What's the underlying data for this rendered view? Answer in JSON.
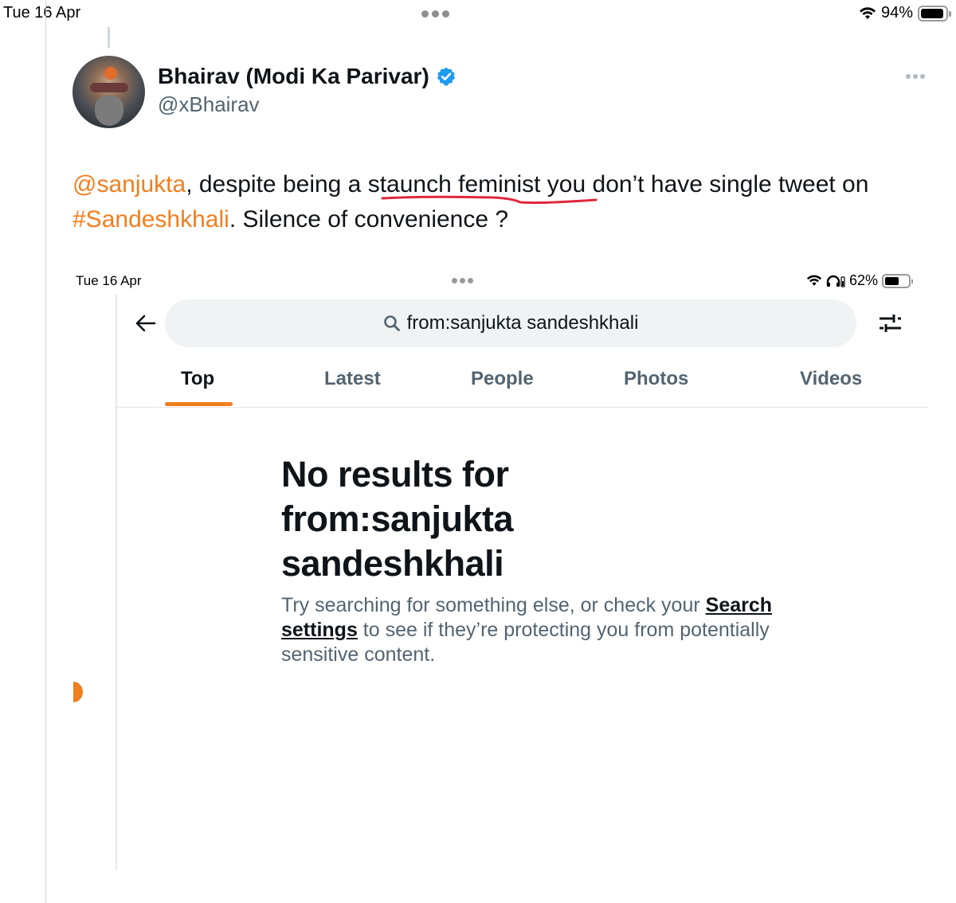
{
  "outer_status": {
    "time": "Tue 16 Apr",
    "battery_percent_label": "94%",
    "battery_level": 0.94,
    "icons": [
      "multitask-dots-icon",
      "wifi-icon",
      "battery-icon"
    ]
  },
  "tweet": {
    "author_name": "Bhairav (Modi Ka Parivar)",
    "author_handle": "@xBhairav",
    "verified": true,
    "more_icon": "more-horizontal-icon",
    "text_parts": {
      "mention": "@sanjukta",
      "part1": ", despite being a staunch feminist you don’t have single tweet on ",
      "hashtag": "#Sandeshkhali",
      "part2": ". Silence of convenience ?"
    },
    "annotation": "red-underline under 'staunch feminist'",
    "colors": {
      "link": "#f07e1f",
      "annotation": "#e0283c",
      "verified": "#1d9bf0"
    }
  },
  "embedded_screenshot": {
    "status": {
      "time": "Tue 16 Apr",
      "battery_percent_label": "62%",
      "battery_level": 0.62,
      "icons": [
        "wifi-icon",
        "headphones-icon",
        "battery-icon"
      ]
    },
    "search": {
      "back_icon": "arrow-left-icon",
      "query": "from:sanjukta sandeshkhali",
      "search_icon": "search-icon",
      "filter_icon": "sliders-icon"
    },
    "tabs": [
      {
        "label": "Top",
        "active": true
      },
      {
        "label": "Latest",
        "active": false
      },
      {
        "label": "People",
        "active": false
      },
      {
        "label": "Photos",
        "active": false
      },
      {
        "label": "Videos",
        "active": false
      }
    ],
    "empty_state": {
      "title_line1": "No results for",
      "title_line2": "from:sanjukta",
      "title_line3": "sandeshkhali",
      "desc_part1": "Try searching for something else, or check your ",
      "desc_link": "Search settings",
      "desc_part2": " to see if they’re protecting you from potentially sensitive content."
    },
    "accent_color": "#f07e1f"
  }
}
